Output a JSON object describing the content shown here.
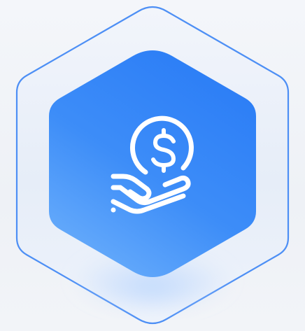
{
  "icon": {
    "name": "hand-holding-dollar-icon",
    "symbol": "$"
  },
  "colors": {
    "background": "#f3f5f9",
    "outer_hexagon_stroke": "#4d8ff5",
    "outer_hexagon_fill": "#e8eefa",
    "inner_hexagon_top": "#2f80f7",
    "inner_hexagon_bottom": "#63a7fb",
    "glyph": "#ffffff"
  }
}
